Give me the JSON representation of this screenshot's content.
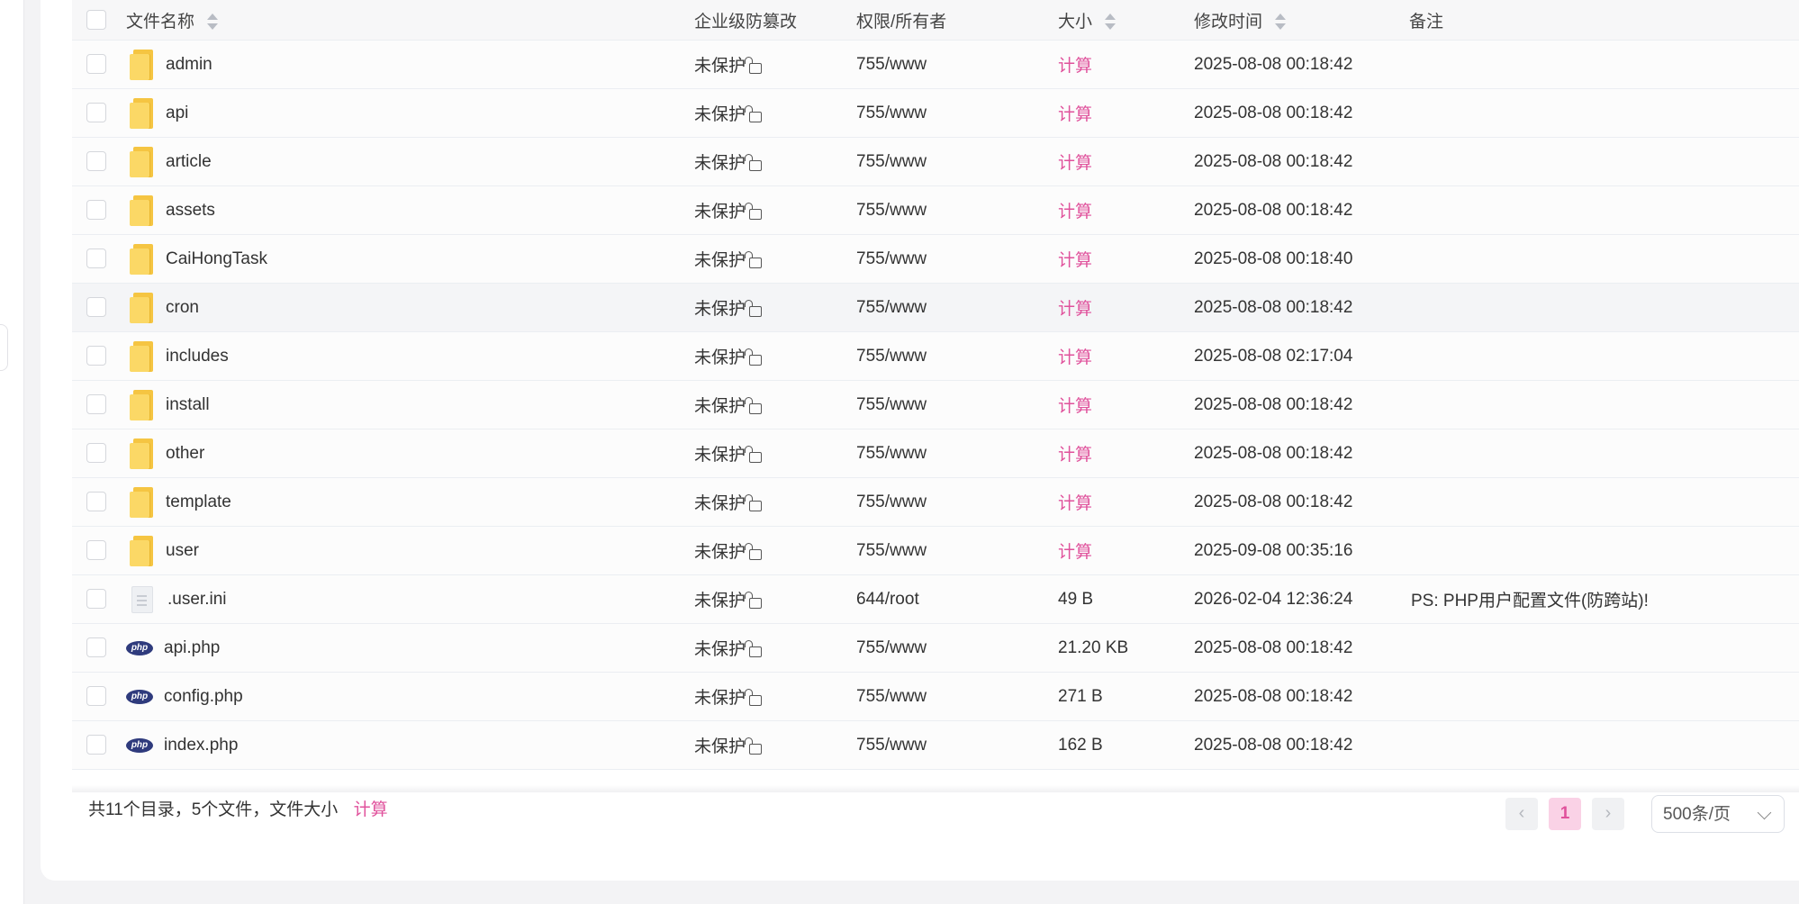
{
  "table": {
    "headers": {
      "name": "文件名称",
      "protect": "企业级防篡改",
      "perm": "权限/所有者",
      "size": "大小",
      "mtime": "修改时间",
      "note": "备注"
    },
    "rows": [
      {
        "type": "folder",
        "name": "admin",
        "protect": "未保护",
        "perm": "755/www",
        "size": "计算",
        "mtime": "2025-08-08 00:18:42",
        "note": ""
      },
      {
        "type": "folder",
        "name": "api",
        "protect": "未保护",
        "perm": "755/www",
        "size": "计算",
        "mtime": "2025-08-08 00:18:42",
        "note": ""
      },
      {
        "type": "folder",
        "name": "article",
        "protect": "未保护",
        "perm": "755/www",
        "size": "计算",
        "mtime": "2025-08-08 00:18:42",
        "note": ""
      },
      {
        "type": "folder",
        "name": "assets",
        "protect": "未保护",
        "perm": "755/www",
        "size": "计算",
        "mtime": "2025-08-08 00:18:42",
        "note": ""
      },
      {
        "type": "folder",
        "name": "CaiHongTask",
        "protect": "未保护",
        "perm": "755/www",
        "size": "计算",
        "mtime": "2025-08-08 00:18:40",
        "note": ""
      },
      {
        "type": "folder",
        "name": "cron",
        "protect": "未保护",
        "perm": "755/www",
        "size": "计算",
        "mtime": "2025-08-08 00:18:42",
        "note": "",
        "hover": true
      },
      {
        "type": "folder",
        "name": "includes",
        "protect": "未保护",
        "perm": "755/www",
        "size": "计算",
        "mtime": "2025-08-08 02:17:04",
        "note": ""
      },
      {
        "type": "folder",
        "name": "install",
        "protect": "未保护",
        "perm": "755/www",
        "size": "计算",
        "mtime": "2025-08-08 00:18:42",
        "note": ""
      },
      {
        "type": "folder",
        "name": "other",
        "protect": "未保护",
        "perm": "755/www",
        "size": "计算",
        "mtime": "2025-08-08 00:18:42",
        "note": ""
      },
      {
        "type": "folder",
        "name": "template",
        "protect": "未保护",
        "perm": "755/www",
        "size": "计算",
        "mtime": "2025-08-08 00:18:42",
        "note": ""
      },
      {
        "type": "folder",
        "name": "user",
        "protect": "未保护",
        "perm": "755/www",
        "size": "计算",
        "mtime": "2025-09-08 00:35:16",
        "note": ""
      },
      {
        "type": "doc",
        "name": ".user.ini",
        "protect": "未保护",
        "perm": "644/root",
        "size": "49 B",
        "mtime": "2026-02-04 12:36:24",
        "note": "PS: PHP用户配置文件(防跨站)!"
      },
      {
        "type": "php",
        "name": "api.php",
        "protect": "未保护",
        "perm": "755/www",
        "size": "21.20 KB",
        "mtime": "2025-08-08 00:18:42",
        "note": ""
      },
      {
        "type": "php",
        "name": "config.php",
        "protect": "未保护",
        "perm": "755/www",
        "size": "271 B",
        "mtime": "2025-08-08 00:18:42",
        "note": ""
      },
      {
        "type": "php",
        "name": "index.php",
        "protect": "未保护",
        "perm": "755/www",
        "size": "162 B",
        "mtime": "2025-08-08 00:18:42",
        "note": ""
      }
    ]
  },
  "footer": {
    "summary": "共11个目录，5个文件，文件大小",
    "calc_label": "计算",
    "prev": "‹",
    "page": "1",
    "next": "›",
    "page_size": "500条/页"
  },
  "colors": {
    "accent": "#e0529c",
    "folder": "#f5c542",
    "php": "#2f3b7d"
  }
}
